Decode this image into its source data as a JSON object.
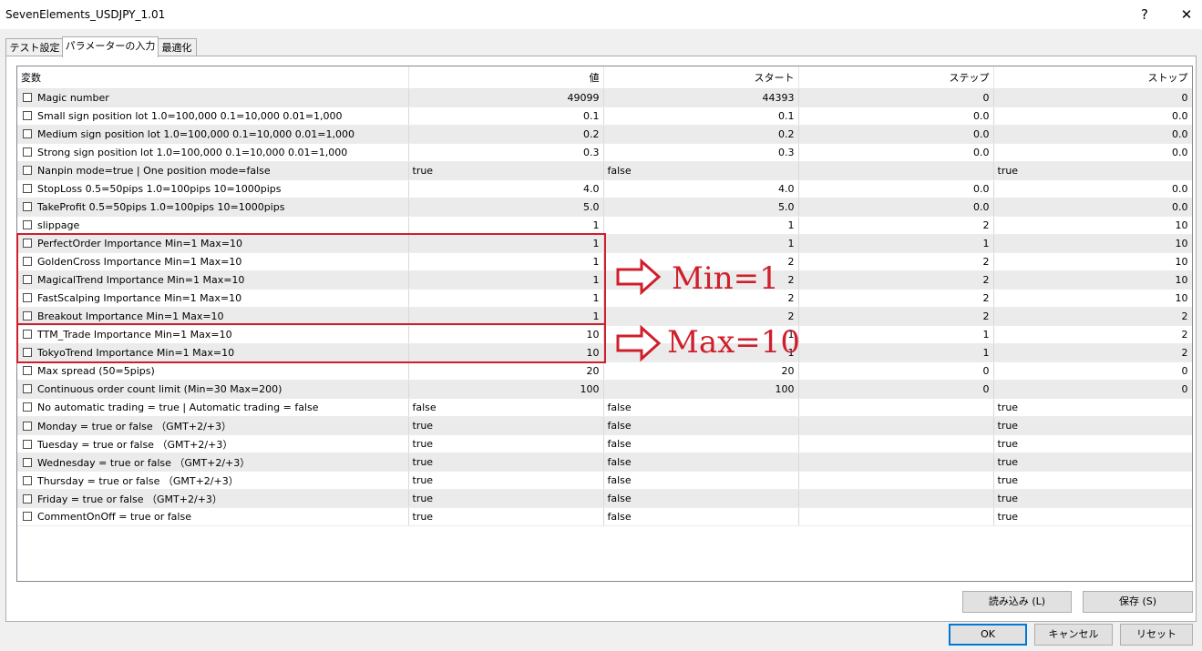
{
  "window": {
    "title": "SevenElements_USDJPY_1.01",
    "help_glyph": "?",
    "close_glyph": "✕"
  },
  "tabs": [
    {
      "label": "テスト設定"
    },
    {
      "label": "パラメーターの入力"
    },
    {
      "label": "最適化"
    }
  ],
  "grid": {
    "columns": [
      "変数",
      "値",
      "スタート",
      "ステップ",
      "ストップ"
    ],
    "rows": [
      {
        "name": "Magic number",
        "value": "49099",
        "start": "44393",
        "step": "0",
        "stop": "0"
      },
      {
        "name": "Small sign position lot 1.0=100,000 0.1=10,000 0.01=1,000",
        "value": "0.1",
        "start": "0.1",
        "step": "0.0",
        "stop": "0.0"
      },
      {
        "name": "Medium sign position lot 1.0=100,000 0.1=10,000 0.01=1,000",
        "value": "0.2",
        "start": "0.2",
        "step": "0.0",
        "stop": "0.0"
      },
      {
        "name": "Strong sign position lot 1.0=100,000 0.1=10,000 0.01=1,000",
        "value": "0.3",
        "start": "0.3",
        "step": "0.0",
        "stop": "0.0"
      },
      {
        "name": "Nanpin mode=true | One position mode=false",
        "value": "true",
        "start": "false",
        "step": "",
        "stop": "true"
      },
      {
        "name": "StopLoss 0.5=50pips   1.0=100pips   10=1000pips",
        "value": "4.0",
        "start": "4.0",
        "step": "0.0",
        "stop": "0.0"
      },
      {
        "name": "TakeProfit 0.5=50pips   1.0=100pips   10=1000pips",
        "value": "5.0",
        "start": "5.0",
        "step": "0.0",
        "stop": "0.0"
      },
      {
        "name": "slippage",
        "value": "1",
        "start": "1",
        "step": "2",
        "stop": "10"
      },
      {
        "name": "PerfectOrder Importance Min=1 Max=10",
        "value": "1",
        "start": "1",
        "step": "1",
        "stop": "10"
      },
      {
        "name": "GoldenCross Importance Min=1 Max=10",
        "value": "1",
        "start": "2",
        "step": "2",
        "stop": "10"
      },
      {
        "name": "MagicalTrend Importance Min=1 Max=10",
        "value": "1",
        "start": "2",
        "step": "2",
        "stop": "10"
      },
      {
        "name": "FastScalping Importance Min=1 Max=10",
        "value": "1",
        "start": "2",
        "step": "2",
        "stop": "10"
      },
      {
        "name": "Breakout Importance Min=1 Max=10",
        "value": "1",
        "start": "2",
        "step": "2",
        "stop": "2"
      },
      {
        "name": "TTM_Trade Importance Min=1 Max=10",
        "value": "10",
        "start": "1",
        "step": "1",
        "stop": "2"
      },
      {
        "name": "TokyoTrend Importance Min=1 Max=10",
        "value": "10",
        "start": "1",
        "step": "1",
        "stop": "2"
      },
      {
        "name": "Max spread (50=5pips)",
        "value": "20",
        "start": "20",
        "step": "0",
        "stop": "0"
      },
      {
        "name": "Continuous order count limit (Min=30   Max=200)",
        "value": "100",
        "start": "100",
        "step": "0",
        "stop": "0"
      },
      {
        "name": "No automatic trading = true | Automatic trading = false",
        "value": "false",
        "start": "false",
        "step": "",
        "stop": "true"
      },
      {
        "name": "Monday = true or false （GMT+2/+3）",
        "value": "true",
        "start": "false",
        "step": "",
        "stop": "true"
      },
      {
        "name": "Tuesday = true or false （GMT+2/+3）",
        "value": "true",
        "start": "false",
        "step": "",
        "stop": "true"
      },
      {
        "name": "Wednesday = true or false （GMT+2/+3）",
        "value": "true",
        "start": "false",
        "step": "",
        "stop": "true"
      },
      {
        "name": "Thursday = true or false （GMT+2/+3）",
        "value": "true",
        "start": "false",
        "step": "",
        "stop": "true"
      },
      {
        "name": "Friday = true or false （GMT+2/+3）",
        "value": "true",
        "start": "false",
        "step": "",
        "stop": "true"
      },
      {
        "name": "CommentOnOff = true or false",
        "value": "true",
        "start": "false",
        "step": "",
        "stop": "true"
      }
    ]
  },
  "annotations": {
    "min_label": "Min=1",
    "max_label": "Max=10",
    "color": "#d01f2c"
  },
  "buttons": {
    "load": "読み込み (L)",
    "save": "保存 (S)",
    "ok": "OK",
    "cancel": "キャンセル",
    "reset": "リセット"
  }
}
